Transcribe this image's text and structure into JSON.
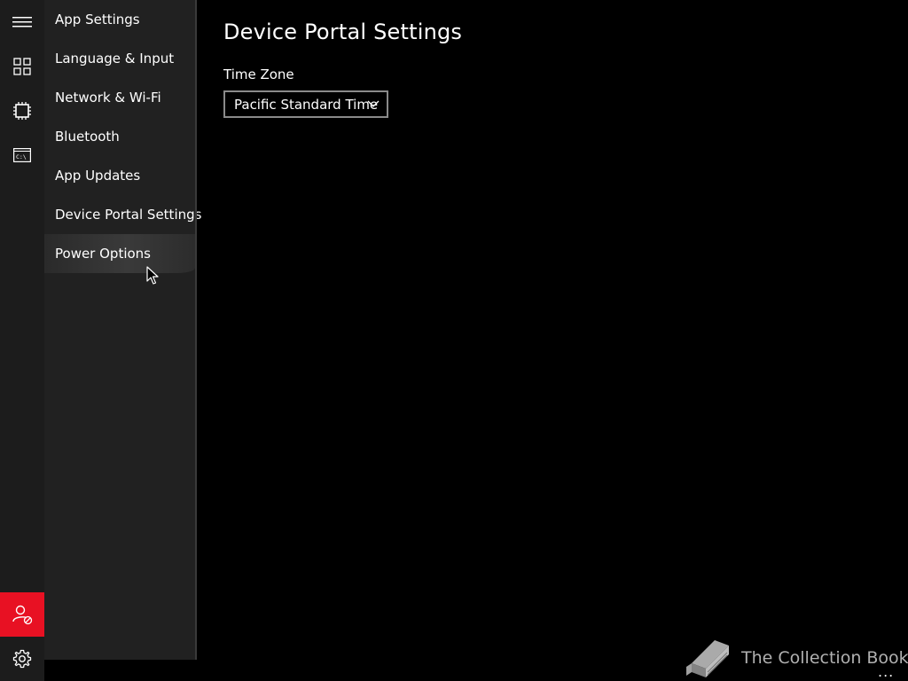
{
  "menu": {
    "items": [
      {
        "label": "App Settings"
      },
      {
        "label": "Language & Input"
      },
      {
        "label": "Network & Wi-Fi"
      },
      {
        "label": "Bluetooth"
      },
      {
        "label": "App Updates"
      },
      {
        "label": "Device Portal Settings"
      },
      {
        "label": "Power Options"
      }
    ],
    "hovered_item": "Power Options"
  },
  "rail": {
    "icons": [
      "hamburger-icon",
      "dashboard-icon",
      "chip-icon",
      "command-prompt-icon",
      "user-blocked-icon",
      "gear-icon"
    ],
    "accent_color": "#e81123"
  },
  "main": {
    "title": "Device Portal Settings",
    "time_zone": {
      "label": "Time Zone",
      "selected": "Pacific Standard Time"
    }
  },
  "watermark": {
    "text": "The Collection Book"
  },
  "overflow": {
    "label": "..."
  }
}
